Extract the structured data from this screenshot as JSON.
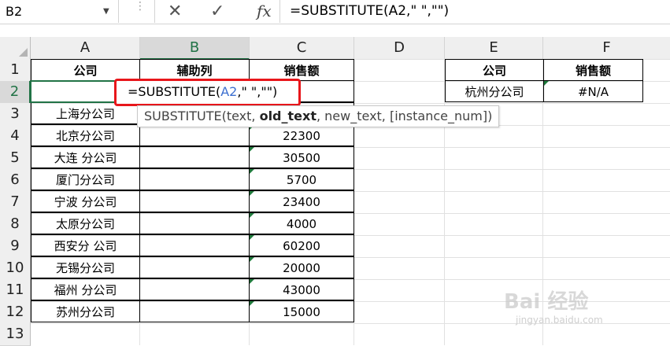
{
  "namebox": {
    "value": "B2"
  },
  "formula_bar": {
    "cancel_icon": "close-icon",
    "enter_icon": "check-icon",
    "fx_label": "fx",
    "formula": "=SUBSTITUTE(A2,\" \",\"\")"
  },
  "columns": [
    "A",
    "B",
    "C",
    "D",
    "E",
    "F"
  ],
  "rows": [
    "1",
    "2",
    "3",
    "4",
    "5",
    "6",
    "7",
    "8",
    "9",
    "10",
    "11",
    "12",
    "13"
  ],
  "table1": {
    "headers": {
      "company": "公司",
      "helper": "辅助列",
      "sales": "销售额"
    },
    "companies": [
      "上海分公司",
      "北京分公司",
      "大连 分公司",
      "厦门分公司",
      "宁波 分公司",
      "太原分公司",
      "西安分 公司",
      "无锡分公司",
      "福州 分公司",
      "苏州分公司"
    ],
    "sales": [
      "22300",
      "30500",
      "5700",
      "23400",
      "4000",
      "60200",
      "20000",
      "43000",
      "15000"
    ]
  },
  "table2": {
    "headers": {
      "company": "公司",
      "sales": "销售额"
    },
    "company": "杭州分公司",
    "sales": "#N/A"
  },
  "editing": {
    "prefix": "=SUBSTITUTE(",
    "ref": "A2",
    "suffix": ",\" \",\"\")"
  },
  "tooltip": {
    "func": "SUBSTITUTE(",
    "arg1": "text, ",
    "arg2": "old_text",
    "rest": ", new_text, [instance_num])"
  },
  "watermark": {
    "logo": "Bai 经验",
    "url": "jingyan.baidu.com"
  }
}
